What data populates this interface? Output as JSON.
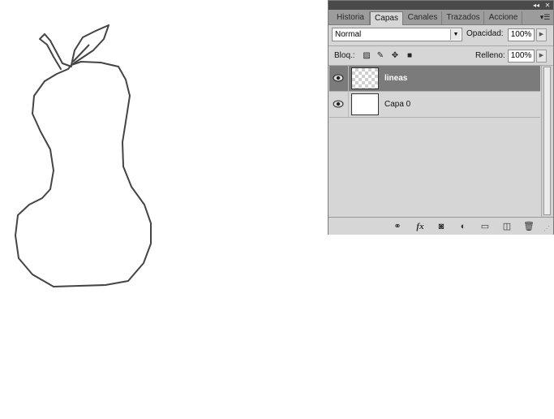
{
  "panel": {
    "topbar": {
      "collapse_icon": "double-chevron-left-icon",
      "close_icon": "close-icon"
    },
    "tabs": [
      {
        "label": "Historia",
        "active": false
      },
      {
        "label": "Capas",
        "active": true
      },
      {
        "label": "Canales",
        "active": false
      },
      {
        "label": "Trazados",
        "active": false
      },
      {
        "label": "Accione",
        "active": false
      }
    ],
    "menu_icon": "panel-menu-icon",
    "blend_mode": "Normal",
    "opacity_label": "Opacidad:",
    "opacity_value": "100%",
    "lock_label": "Bloq.:",
    "fill_label": "Relleno:",
    "fill_value": "100%",
    "layers": [
      {
        "name": "lineas",
        "selected": true,
        "visible": true,
        "transparent": true
      },
      {
        "name": "Capa 0",
        "selected": false,
        "visible": true,
        "transparent": false
      }
    ],
    "bottom_icons": [
      "link-icon",
      "fx-icon",
      "mask-icon",
      "adjustment-icon",
      "folder-icon",
      "new-layer-icon",
      "trash-icon"
    ],
    "fx_label": "fx"
  },
  "colors": {
    "panel_bg": "#d6d6d6",
    "selected_layer": "#7b7b7b",
    "topbar": "#4a4a4a",
    "stroke": "#444444"
  }
}
